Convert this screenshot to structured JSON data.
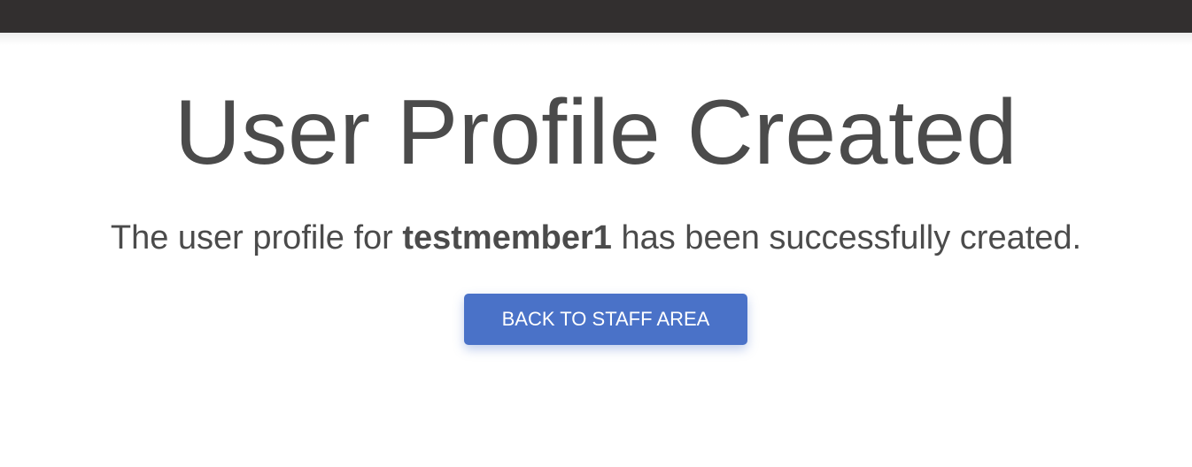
{
  "page": {
    "title": "User Profile Created",
    "message_prefix": "The user profile for ",
    "username": "testmember1",
    "message_suffix": " has been successfully created."
  },
  "actions": {
    "back_label": "BACK TO STAFF AREA"
  },
  "colors": {
    "topbar": "#322f2f",
    "text": "#4b4b4b",
    "button": "#4a72c8",
    "button_text": "#ffffff"
  }
}
